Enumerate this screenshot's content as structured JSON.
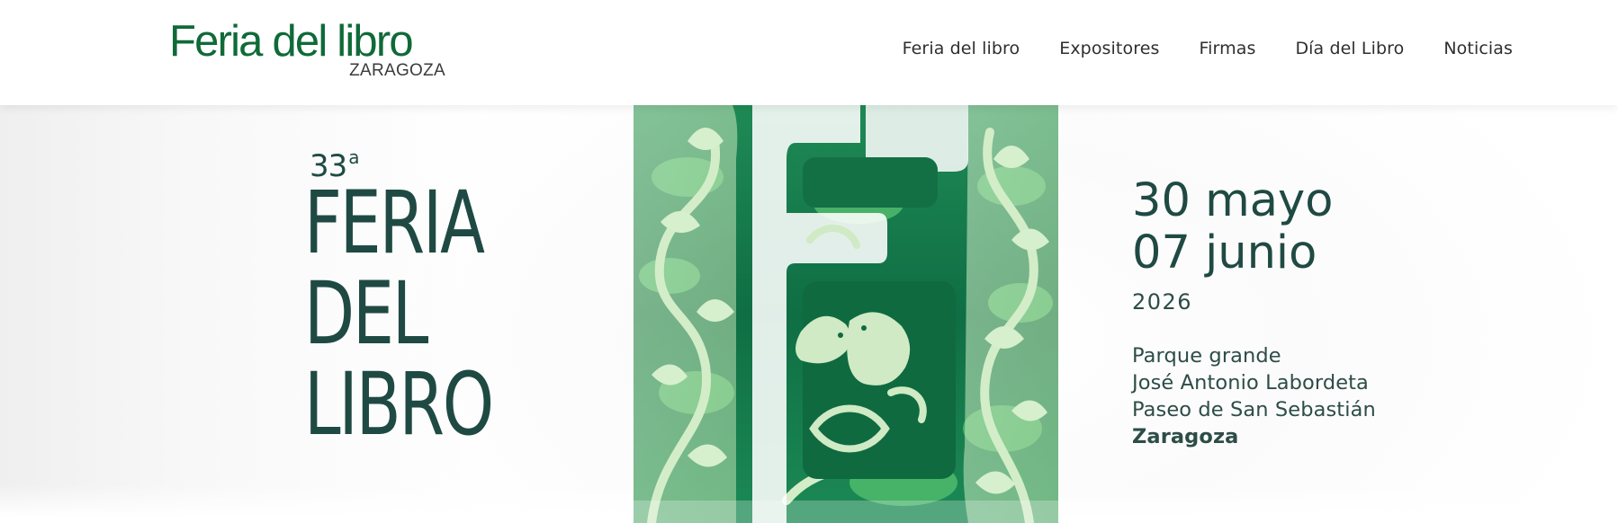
{
  "header": {
    "logo": {
      "title": "Feria del libro",
      "subtitle": "ZARAGOZA"
    },
    "nav": [
      {
        "label": "Feria del libro"
      },
      {
        "label": "Expositores"
      },
      {
        "label": "Firmas"
      },
      {
        "label": "Día del Libro"
      },
      {
        "label": "Noticias"
      }
    ]
  },
  "hero": {
    "edition": "33",
    "edition_suffix": "a",
    "title_lines": [
      "FERIA",
      "DEL",
      "LIBRO"
    ],
    "artwork_icon": "papercut-letter-f-with-birds-and-foliage",
    "dates": [
      "30 mayo",
      "07 junio"
    ],
    "year": "2026",
    "venue": [
      "Parque grande",
      "José Antonio Labordeta",
      "Paseo de San Sebastián"
    ],
    "city": "Zaragoza"
  },
  "colors": {
    "brand_green": "#0f6a38",
    "title_dark_green": "#1f4a43",
    "art_light_green": "#cbe7c0",
    "art_mid_green": "#5fbf6a",
    "art_dark_green": "#1d7a4a"
  }
}
